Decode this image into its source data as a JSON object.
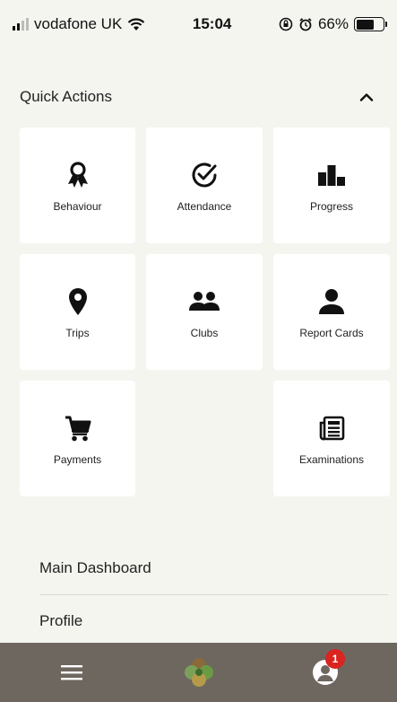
{
  "status_bar": {
    "carrier": "vodafone UK",
    "time": "15:04",
    "battery": "66%",
    "battery_level": 0.66
  },
  "quick_actions": {
    "title": "Quick Actions",
    "items": [
      {
        "label": "Behaviour",
        "icon": "award-icon"
      },
      {
        "label": "Attendance",
        "icon": "check-circle-icon"
      },
      {
        "label": "Progress",
        "icon": "bar-chart-icon"
      },
      {
        "label": "Trips",
        "icon": "map-pin-icon"
      },
      {
        "label": "Clubs",
        "icon": "group-icon"
      },
      {
        "label": "Report Cards",
        "icon": "person-icon"
      },
      {
        "label": "Payments",
        "icon": "cart-icon"
      },
      {
        "label": "Examinations",
        "icon": "newspaper-icon"
      }
    ]
  },
  "menu": {
    "items": [
      {
        "label": "Main Dashboard"
      },
      {
        "label": "Profile"
      }
    ]
  },
  "bottom_bar": {
    "notification_count": "1"
  },
  "colors": {
    "background": "#f5f5f0",
    "card": "#ffffff",
    "bottom_bar": "#6e6760",
    "badge": "#d9241f"
  }
}
